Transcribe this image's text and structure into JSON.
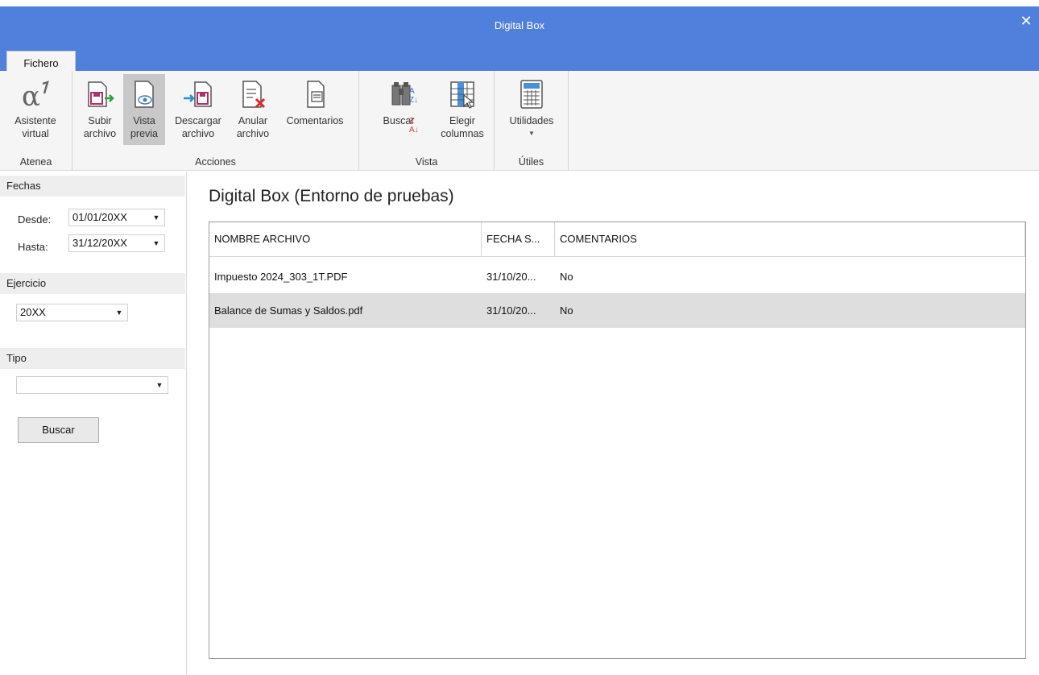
{
  "window": {
    "title": "Digital Box"
  },
  "tabs": [
    {
      "label": "Fichero"
    }
  ],
  "ribbon": {
    "groups": [
      {
        "label": "Atenea"
      },
      {
        "label": "Acciones"
      },
      {
        "label": "Vista"
      },
      {
        "label": "Útiles"
      }
    ],
    "buttons": {
      "asistente": "Asistente\nvirtual",
      "subir": "Subir\narchivo",
      "vista_previa": "Vista\nprevia",
      "descargar": "Descargar\narchivo",
      "anular": "Anular\narchivo",
      "comentarios": "Comentarios",
      "buscar": "Buscar",
      "elegir": "Elegir\ncolumnas",
      "utilidades": "Utilidades"
    }
  },
  "filters": {
    "fechas": {
      "header": "Fechas",
      "desde_label": "Desde:",
      "desde_value": "01/01/20XX",
      "hasta_label": "Hasta:",
      "hasta_value": "31/12/20XX"
    },
    "ejercicio": {
      "header": "Ejercicio",
      "value": "20XX"
    },
    "tipo": {
      "header": "Tipo",
      "value": ""
    },
    "buscar_label": "Buscar"
  },
  "main": {
    "title": "Digital Box (Entorno de pruebas)",
    "columns": [
      "NOMBRE ARCHIVO",
      "FECHA S...",
      "COMENTARIOS"
    ],
    "rows": [
      {
        "nombre": "Impuesto 2024_303_1T.PDF",
        "fecha": "31/10/20...",
        "comentarios": "No"
      },
      {
        "nombre": "Balance de Sumas y Saldos.pdf",
        "fecha": "31/10/20...",
        "comentarios": "No"
      }
    ]
  },
  "colors": {
    "titlebar": "#4f80dc",
    "selected_row": "#dedede"
  }
}
